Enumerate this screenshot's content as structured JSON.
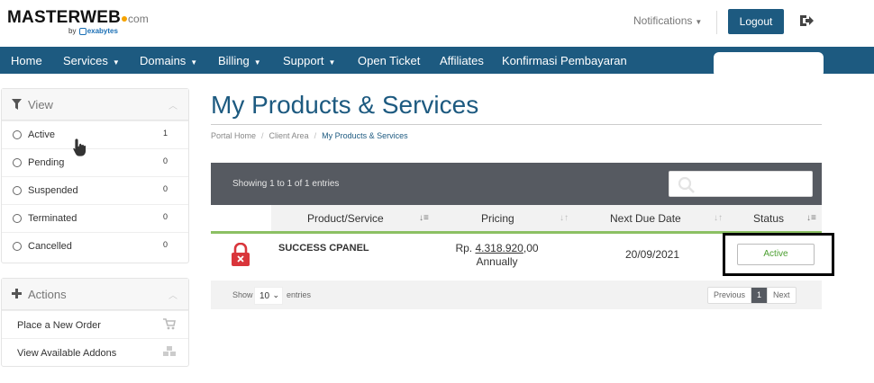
{
  "header": {
    "logo": {
      "main": "MASTERWEB",
      "suffix": "com",
      "by": "by",
      "partner": "exabytes"
    },
    "notifications_label": "Notifications",
    "logout_label": "Logout",
    "exit_icon": "sign-out-icon"
  },
  "nav": {
    "items": [
      {
        "label": "Home",
        "dropdown": false
      },
      {
        "label": "Services",
        "dropdown": true
      },
      {
        "label": "Domains",
        "dropdown": true
      },
      {
        "label": "Billing",
        "dropdown": true
      },
      {
        "label": "Support",
        "dropdown": true
      },
      {
        "label": "Open Ticket",
        "dropdown": false
      },
      {
        "label": "Affiliates",
        "dropdown": false
      },
      {
        "label": "Konfirmasi Pembayaran",
        "dropdown": false
      }
    ]
  },
  "sidebar": {
    "view": {
      "title": "View",
      "icon": "filter-icon",
      "items": [
        {
          "label": "Active",
          "count": "1"
        },
        {
          "label": "Pending",
          "count": "0"
        },
        {
          "label": "Suspended",
          "count": "0"
        },
        {
          "label": "Terminated",
          "count": "0"
        },
        {
          "label": "Cancelled",
          "count": "0"
        }
      ]
    },
    "actions": {
      "title": "Actions",
      "icon": "plus-icon",
      "items": [
        {
          "label": "Place a New Order",
          "icon": "cart-icon"
        },
        {
          "label": "View Available Addons",
          "icon": "cubes-icon"
        }
      ]
    }
  },
  "main": {
    "title": "My Products & Services",
    "breadcrumb": [
      "Portal Home",
      "Client Area",
      "My Products & Services"
    ],
    "table": {
      "showing": "Showing 1 to 1 of 1 entries",
      "columns": [
        "Product/Service",
        "Pricing",
        "Next Due Date",
        "Status"
      ],
      "rows": [
        {
          "product": "SUCCESS CPANEL",
          "price_prefix": "Rp.",
          "price_amount": "4.318.920",
          "price_suffix": ",00",
          "billing_cycle": "Annually",
          "next_due": "20/09/2021",
          "status": "Active"
        }
      ],
      "footer": {
        "show_label": "Show",
        "page_size": "10",
        "entries_label": "entries",
        "pager": [
          "Previous",
          "1",
          "Next"
        ]
      }
    }
  },
  "colors": {
    "brand": "#1d5a80",
    "table_header": "#565a61",
    "status_active": "#4a9e2e",
    "accent_line": "#8cc063",
    "lock": "#d9353b"
  }
}
